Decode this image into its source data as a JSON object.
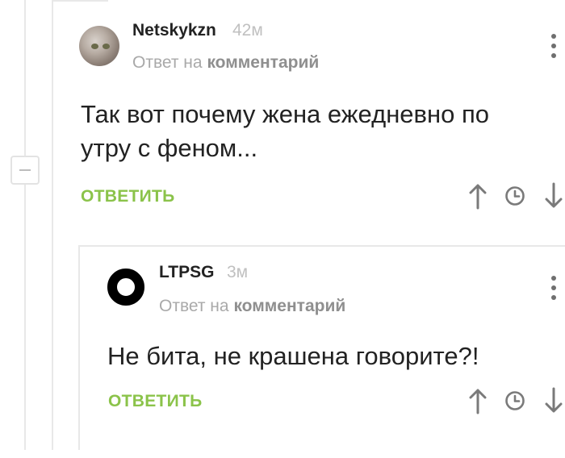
{
  "comments": [
    {
      "username": "Netskykzn",
      "time": "42м",
      "reply_prefix": "Ответ на",
      "reply_target": "комментарий",
      "text": "Так вот почему жена ежедневно по утру с феном...",
      "reply_label": "ОТВЕТИТЬ"
    },
    {
      "username": "LTPSG",
      "time": "3м",
      "reply_prefix": "Ответ на",
      "reply_target": "комментарий",
      "text": "Не бита, не крашена говорите?!",
      "reply_label": "ОТВЕТИТЬ"
    }
  ],
  "icons": [
    "collapse-thread-icon",
    "kebab-menu-icon",
    "upvote-arrow-icon",
    "clock-icon",
    "downvote-arrow-icon"
  ],
  "colors": {
    "accent": "#8bc34a",
    "muted": "#a9a9a9",
    "guide": "#e8e8e8"
  }
}
